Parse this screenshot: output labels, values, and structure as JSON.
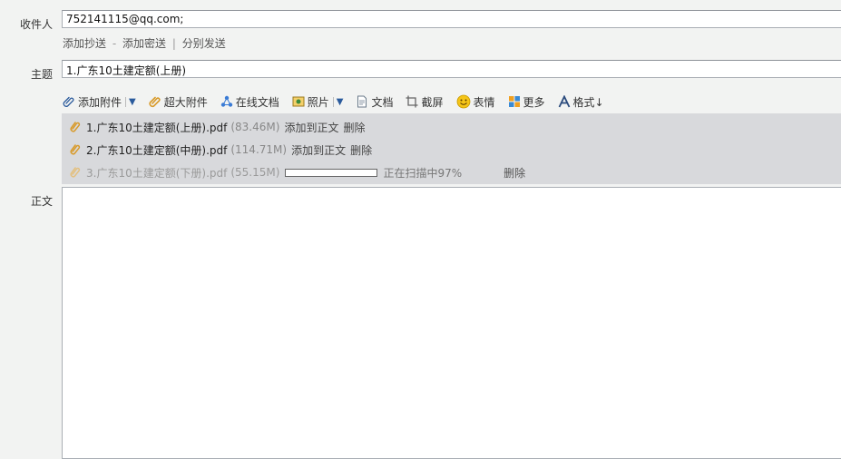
{
  "recipients": {
    "label": "收件人",
    "value": "752141115@qq.com;"
  },
  "recipient_links": {
    "add_cc": "添加抄送",
    "dash": "-",
    "add_bcc": "添加密送",
    "pipe": "|",
    "separate_send": "分别发送"
  },
  "subject": {
    "label": "主题",
    "value": "1.广东10土建定额(上册)"
  },
  "toolbar": {
    "add_attachment": "添加附件",
    "large_attachment": "超大附件",
    "online_doc": "在线文档",
    "photo": "照片",
    "document": "文档",
    "screenshot": "截屏",
    "emoji": "表情",
    "more": "更多",
    "format": "格式↓"
  },
  "attachments": [
    {
      "name": "1.广东10土建定额(上册).pdf",
      "size": "(83.46M)",
      "add_to_body": "添加到正文",
      "delete": "删除"
    },
    {
      "name": "2.广东10土建定额(中册).pdf",
      "size": "(114.71M)",
      "add_to_body": "添加到正文",
      "delete": "删除"
    },
    {
      "name": "3.广东10土建定额(下册).pdf",
      "size": "(55.15M)",
      "status": "正在扫描中97%",
      "progress": 0.97,
      "delete": "删除"
    }
  ],
  "body": {
    "label": "正文"
  },
  "colors": {
    "background": "#f2f3f2",
    "attachment_panel": "#d8d9dc",
    "clip_icon": "#d89a2a",
    "accent": "#2a5a9c"
  }
}
